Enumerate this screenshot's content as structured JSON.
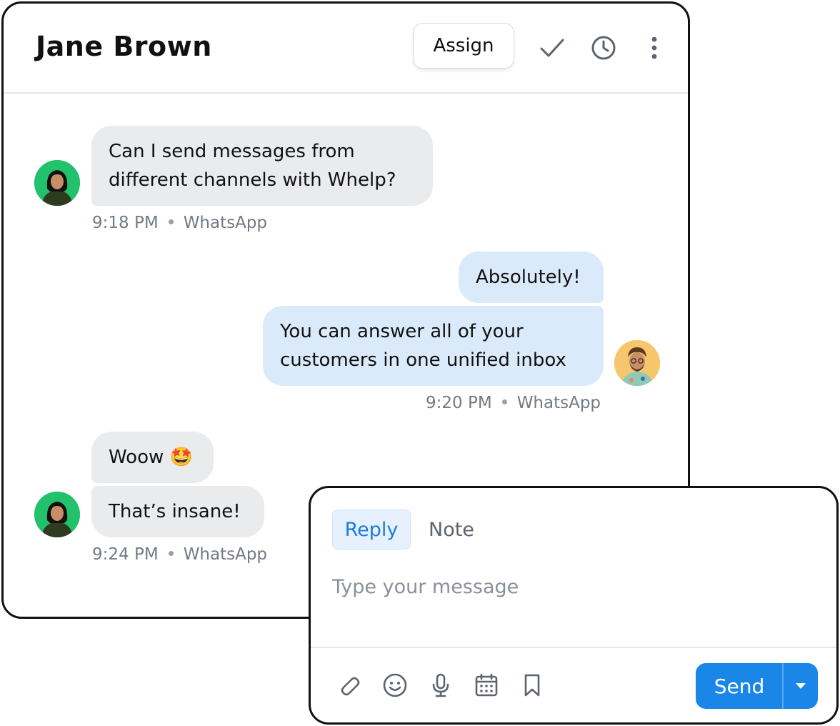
{
  "header": {
    "title": "Jane Brown",
    "assign_label": "Assign",
    "icons": [
      "check-icon",
      "clock-icon",
      "more-vertical-icon"
    ]
  },
  "messages": [
    {
      "direction": "incoming",
      "lines": [
        "Can I send messages from",
        "different channels with Whelp?"
      ],
      "time": "9:18 PM",
      "channel": "WhatsApp"
    },
    {
      "direction": "outgoing",
      "bubbles": [
        "Absolutely!",
        [
          "You can answer all of your",
          "customers in one unified inbox"
        ]
      ],
      "time": "9:20 PM",
      "channel": "WhatsApp"
    },
    {
      "direction": "incoming",
      "bubbles": [
        "Woow 🤩",
        "That’s insane!"
      ],
      "time": "9:24 PM",
      "channel": "WhatsApp"
    }
  ],
  "composer": {
    "tabs": [
      {
        "label": "Reply",
        "active": true
      },
      {
        "label": "Note",
        "active": false
      }
    ],
    "placeholder": "Type your message",
    "toolbar_icons": [
      "paperclip-icon",
      "smiley-icon",
      "microphone-icon",
      "calendar-icon",
      "bookmark-icon"
    ],
    "send_label": "Send"
  },
  "colors": {
    "accent": "#1a86e8",
    "incoming_bubble": "#eaebed",
    "outgoing_bubble": "#dbeafb",
    "contact_avatar_bg": "#22c16b",
    "agent_avatar_bg": "#f5c66b"
  }
}
